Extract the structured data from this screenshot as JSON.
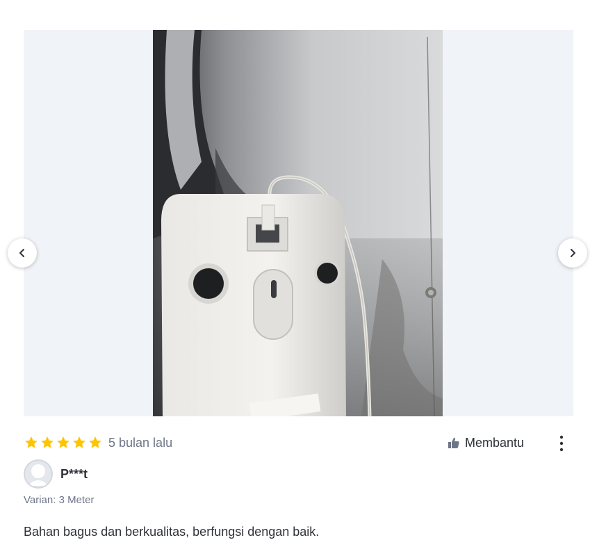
{
  "review": {
    "rating": 5,
    "max_rating": 5,
    "time_ago": "5 bulan lalu",
    "helpful_label": "Membantu",
    "username": "P***t",
    "variant": "Varian: 3 Meter",
    "text": "Bahan bagus dan berkualitas, berfungsi dengan baik."
  },
  "gallery": {
    "prev_icon": "chevron-left-icon",
    "next_icon": "chevron-right-icon"
  },
  "icons": {
    "star": "star-icon",
    "helpful": "thumbs-up-icon",
    "more": "kebab-menu-icon",
    "avatar": "user-placeholder-icon"
  },
  "colors": {
    "star": "#ffc400",
    "muted_text": "#6d7588",
    "text": "#2e3137",
    "gallery_bg": "#f0f3f7"
  }
}
